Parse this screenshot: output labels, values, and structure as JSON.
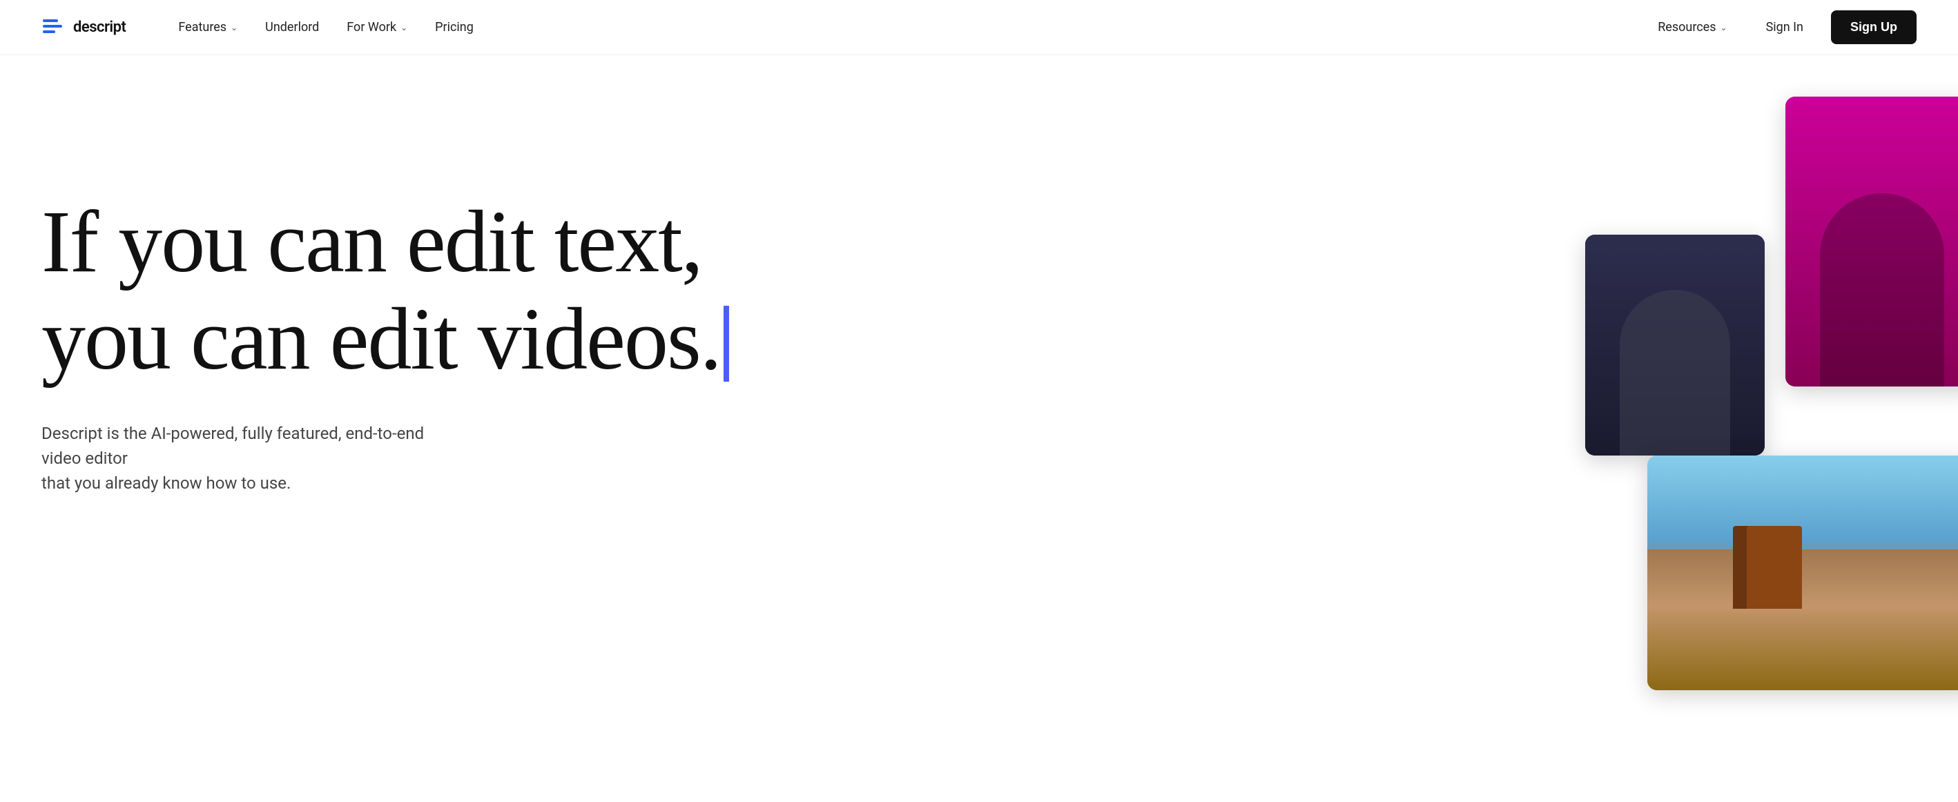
{
  "nav": {
    "logo": {
      "text": "descript"
    },
    "items_left": [
      {
        "id": "features",
        "label": "Features",
        "has_dropdown": true
      },
      {
        "id": "underlord",
        "label": "Underlord",
        "has_dropdown": false
      },
      {
        "id": "for-work",
        "label": "For Work",
        "has_dropdown": true
      },
      {
        "id": "pricing",
        "label": "Pricing",
        "has_dropdown": false
      }
    ],
    "items_right": [
      {
        "id": "resources",
        "label": "Resources",
        "has_dropdown": true
      }
    ],
    "signin_label": "Sign In",
    "signup_label": "Sign Up"
  },
  "hero": {
    "headline_line1": "If you can edit text,",
    "headline_line2": "you can edit videos.",
    "subtext_line1": "Descript is the AI-powered, fully featured, end-to-end video editor",
    "subtext_line2": "that you already know how to use."
  }
}
